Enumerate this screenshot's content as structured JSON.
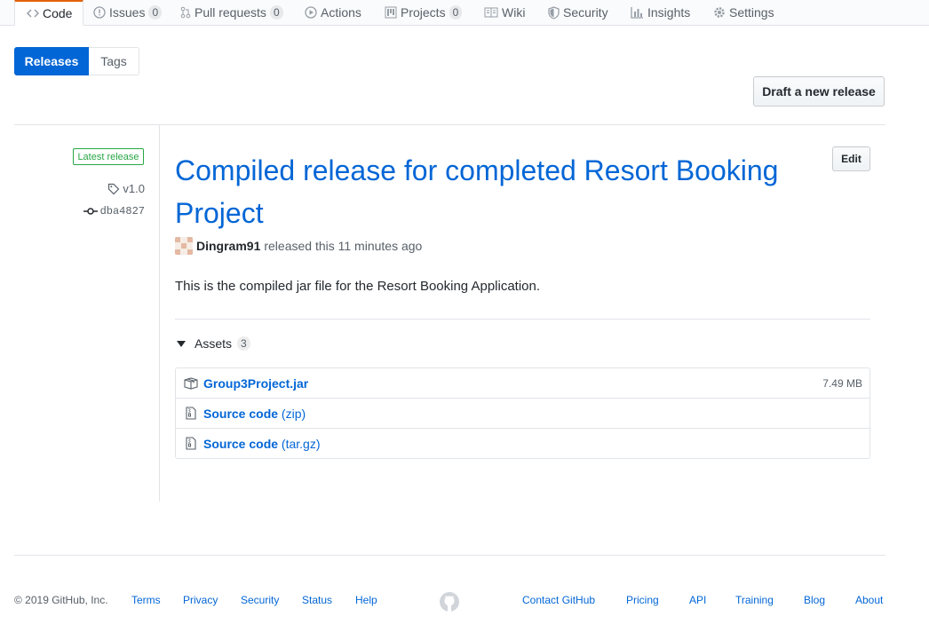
{
  "reponav": {
    "tabs": [
      {
        "label": "Code",
        "icon": "code-icon",
        "counter": null
      },
      {
        "label": "Issues",
        "icon": "issue-icon",
        "counter": "0"
      },
      {
        "label": "Pull requests",
        "icon": "pull-request-icon",
        "counter": "0"
      },
      {
        "label": "Actions",
        "icon": "play-icon",
        "counter": null
      },
      {
        "label": "Projects",
        "icon": "project-icon",
        "counter": "0"
      },
      {
        "label": "Wiki",
        "icon": "book-icon",
        "counter": null
      },
      {
        "label": "Security",
        "icon": "shield-icon",
        "counter": null
      },
      {
        "label": "Insights",
        "icon": "graph-icon",
        "counter": null
      },
      {
        "label": "Settings",
        "icon": "gear-icon",
        "counter": null
      }
    ]
  },
  "subnav": {
    "releases": "Releases",
    "tags": "Tags"
  },
  "draft_button": "Draft a new release",
  "release": {
    "badge": "Latest release",
    "tag": "v1.0",
    "commit": "dba4827",
    "edit": "Edit",
    "title": "Compiled release for completed Resort Booking Project",
    "author": "Dingram91",
    "released_text": "released this 11 minutes ago",
    "description": "This is the compiled jar file for the Resort Booking Application.",
    "assets_label": "Assets",
    "assets_count": "3",
    "assets": [
      {
        "name": "Group3Project.jar",
        "suffix": "",
        "size": "7.49 MB",
        "icon": "package-icon"
      },
      {
        "name": "Source code",
        "suffix": "(zip)",
        "size": "",
        "icon": "file-zip-icon"
      },
      {
        "name": "Source code",
        "suffix": "(tar.gz)",
        "size": "",
        "icon": "file-zip-icon"
      }
    ]
  },
  "footer": {
    "copyright": "© 2019 GitHub, Inc.",
    "left_links": [
      "Terms",
      "Privacy",
      "Security",
      "Status",
      "Help"
    ],
    "right_links": [
      "Contact GitHub",
      "Pricing",
      "API",
      "Training",
      "Blog",
      "About"
    ]
  },
  "colors": {
    "accent": "#0366d6",
    "success": "#28a745",
    "tab_highlight": "#e36209"
  }
}
